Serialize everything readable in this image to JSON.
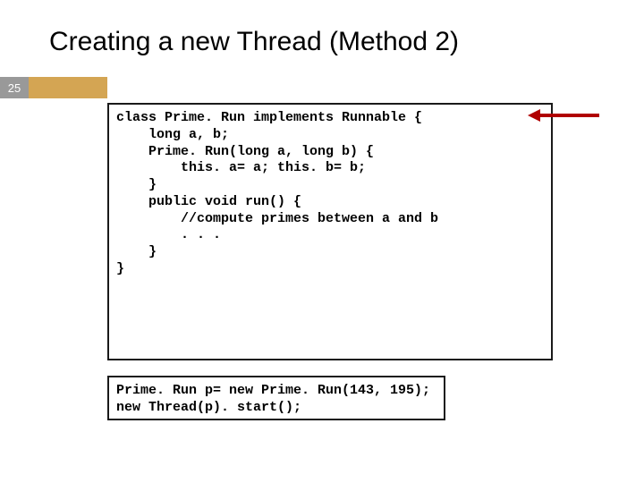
{
  "title": "Creating a new Thread (Method 2)",
  "pageNumber": "25",
  "code1": {
    "l1": "class Prime. Run implements Runnable {",
    "l2": "    long a, b;",
    "l3": "",
    "l4": "    Prime. Run(long a, long b) {",
    "l5": "        this. a= a; this. b= b;",
    "l6": "    }",
    "l7": "",
    "l8": "    public void run() {",
    "l9": "        //compute primes between a and b",
    "l10": "        . . .",
    "l11": "    }",
    "l12": "}"
  },
  "code2": {
    "l1": "Prime. Run p= new Prime. Run(143, 195);",
    "l2": "new Thread(p). start();"
  }
}
